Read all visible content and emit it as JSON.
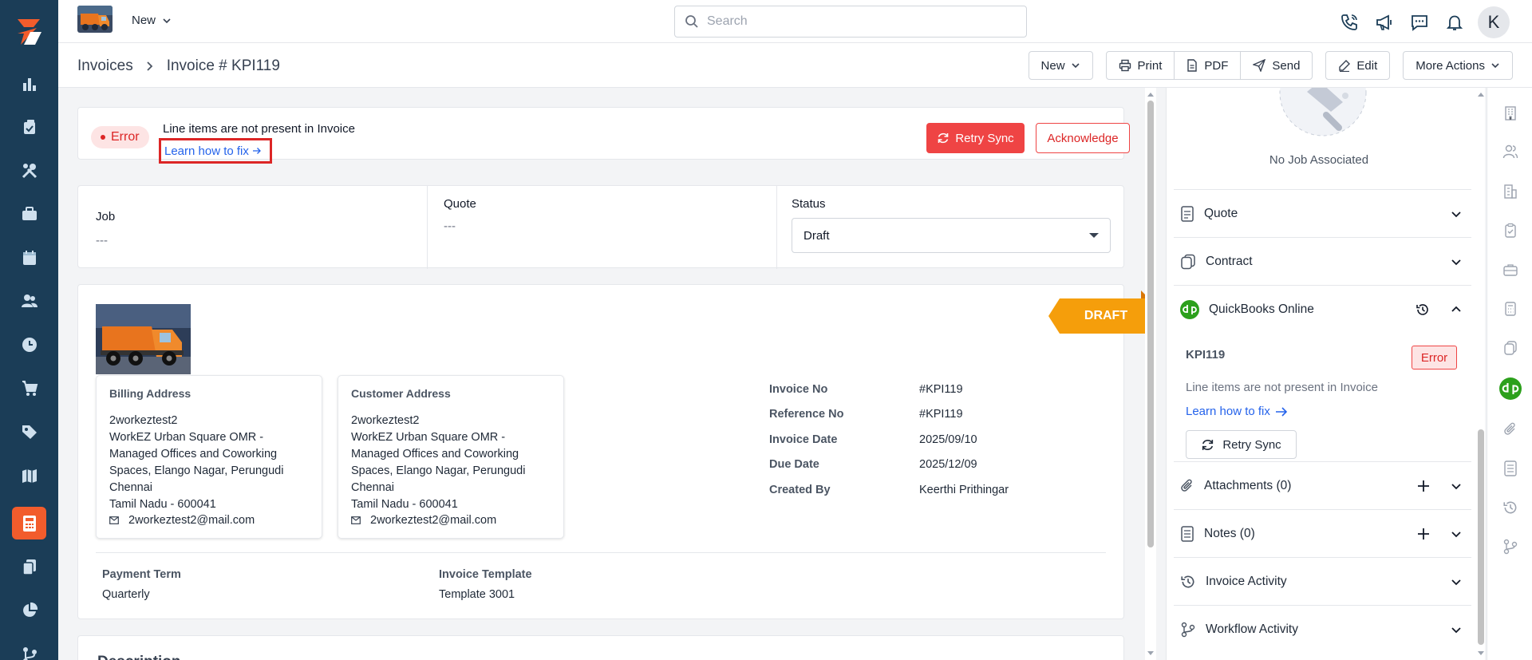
{
  "topbar": {
    "new_label": "New",
    "search_placeholder": "Search",
    "avatar_letter": "K"
  },
  "breadcrumb": {
    "parent": "Invoices",
    "current": "Invoice # KPI119"
  },
  "actions": {
    "new": "New",
    "print": "Print",
    "pdf": "PDF",
    "send": "Send",
    "edit": "Edit",
    "more": "More Actions"
  },
  "error_banner": {
    "badge": "Error",
    "message": "Line items are not present in Invoice",
    "learn_link": "Learn how to fix",
    "retry_label": "Retry Sync",
    "ack_label": "Acknowledge"
  },
  "meta": {
    "job_label": "Job",
    "job_value": "---",
    "quote_label": "Quote",
    "quote_value": "---",
    "status_label": "Status",
    "status_value": "Draft"
  },
  "invoice": {
    "ribbon": "DRAFT",
    "billing": {
      "title": "Billing Address",
      "name": "2workeztest2",
      "line1": "WorkEZ Urban Square OMR -",
      "line2": "Managed Offices and Coworking",
      "line3": "Spaces, Elango Nagar, Perungudi",
      "city": "Chennai",
      "state": "Tamil Nadu - 600041",
      "email": "2workeztest2@mail.com"
    },
    "customer": {
      "title": "Customer Address",
      "name": "2workeztest2",
      "line1": "WorkEZ Urban Square OMR -",
      "line2": "Managed Offices and Coworking",
      "line3": "Spaces, Elango Nagar, Perungudi",
      "city": "Chennai",
      "state": "Tamil Nadu - 600041",
      "email": "2workeztest2@mail.com"
    },
    "info": [
      {
        "key": "Invoice No",
        "value": "#KPI119"
      },
      {
        "key": "Reference No",
        "value": "#KPI119"
      },
      {
        "key": "Invoice Date",
        "value": "2025/09/10"
      },
      {
        "key": "Due Date",
        "value": "2025/12/09"
      },
      {
        "key": "Created By",
        "value": "Keerthi Prithingar"
      }
    ],
    "payment_term_label": "Payment Term",
    "payment_term_value": "Quarterly",
    "template_label": "Invoice Template",
    "template_value": "Template 3001",
    "description_title": "Description"
  },
  "right_panel": {
    "no_job": "No Job Associated",
    "quote": "Quote",
    "contract": "Contract",
    "qbo_title": "QuickBooks Online",
    "qbo_id": "KPI119",
    "qbo_badge": "Error",
    "qbo_message": "Line items are not present in Invoice",
    "qbo_learn": "Learn how to fix",
    "qbo_retry": "Retry Sync",
    "attachments": "Attachments (0)",
    "notes": "Notes (0)",
    "invoice_activity": "Invoice Activity",
    "workflow_activity": "Workflow Activity"
  },
  "colors": {
    "nav_bg": "#1b3d57",
    "accent": "#f25c2c",
    "error": "#ef4444",
    "ribbon": "#f59e0b",
    "link": "#2563eb",
    "qbo_green": "#2ca01c"
  }
}
